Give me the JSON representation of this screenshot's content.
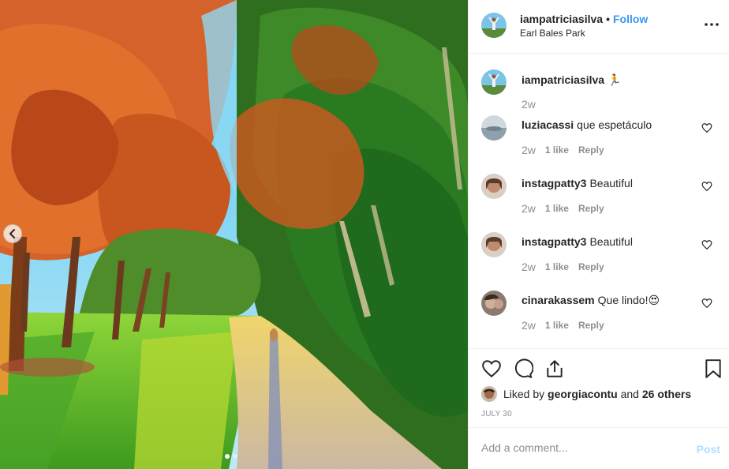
{
  "post": {
    "author": "iampatriciasilva",
    "separator": "•",
    "follow_label": "Follow",
    "location": "Earl Bales Park",
    "more_icon": "more-horizontal-icon",
    "carousel_dots": 2,
    "active_dot": 0
  },
  "caption": {
    "username": "iampatriciasilva",
    "text": "🏃",
    "time": "2w"
  },
  "comments": [
    {
      "username": "luziacassi",
      "text": "que espetáculo",
      "time": "2w",
      "likes": "1 like",
      "reply": "Reply",
      "avatar_color": "#9aa7b0"
    },
    {
      "username": "instagpatty3",
      "text": "Beautiful",
      "time": "2w",
      "likes": "1 like",
      "reply": "Reply",
      "avatar_color": "#b5836e"
    },
    {
      "username": "instagpatty3",
      "text": "Beautiful",
      "time": "2w",
      "likes": "1 like",
      "reply": "Reply",
      "avatar_color": "#b5836e"
    },
    {
      "username": "cinarakassem",
      "text": "Que lindo!😍",
      "time": "2w",
      "likes": "1 like",
      "reply": "Reply",
      "avatar_color": "#6b5a52"
    }
  ],
  "actions": {
    "like_icon": "heart-icon",
    "comment_icon": "comment-icon",
    "share_icon": "share-icon",
    "save_icon": "bookmark-icon"
  },
  "likes": {
    "prefix": "Liked by",
    "user": "georgiacontu",
    "middle": "and",
    "others": "26 others"
  },
  "date": "JULY 30",
  "add_comment": {
    "placeholder": "Add a comment...",
    "post_label": "Post"
  },
  "colors": {
    "link_blue": "#3897f0",
    "post_disabled": "#b2dffc",
    "muted": "#8e8e8e",
    "text": "#262626",
    "border": "#efefef"
  }
}
